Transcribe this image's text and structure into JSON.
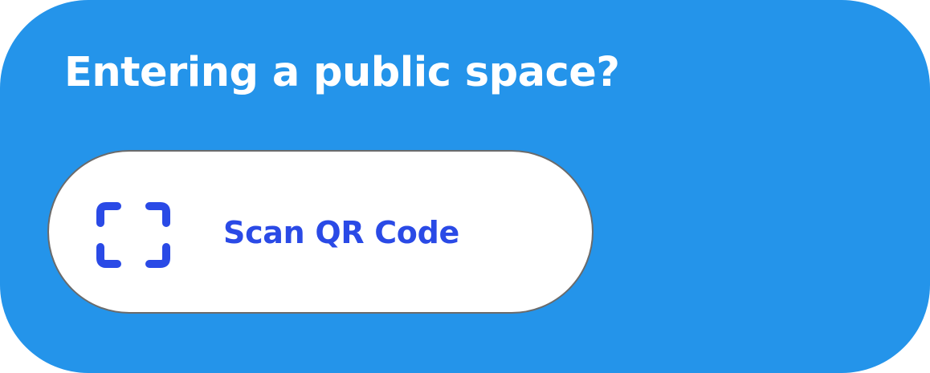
{
  "card": {
    "title": "Entering a public space?"
  },
  "scan_button": {
    "label": "Scan QR Code",
    "icon": "qr-scan-frame-icon"
  },
  "colors": {
    "card_background": "#2494EA",
    "title_text": "#FFFFFF",
    "button_background": "#FFFFFF",
    "button_border": "#6B6B6B",
    "accent": "#2A4AE6"
  }
}
